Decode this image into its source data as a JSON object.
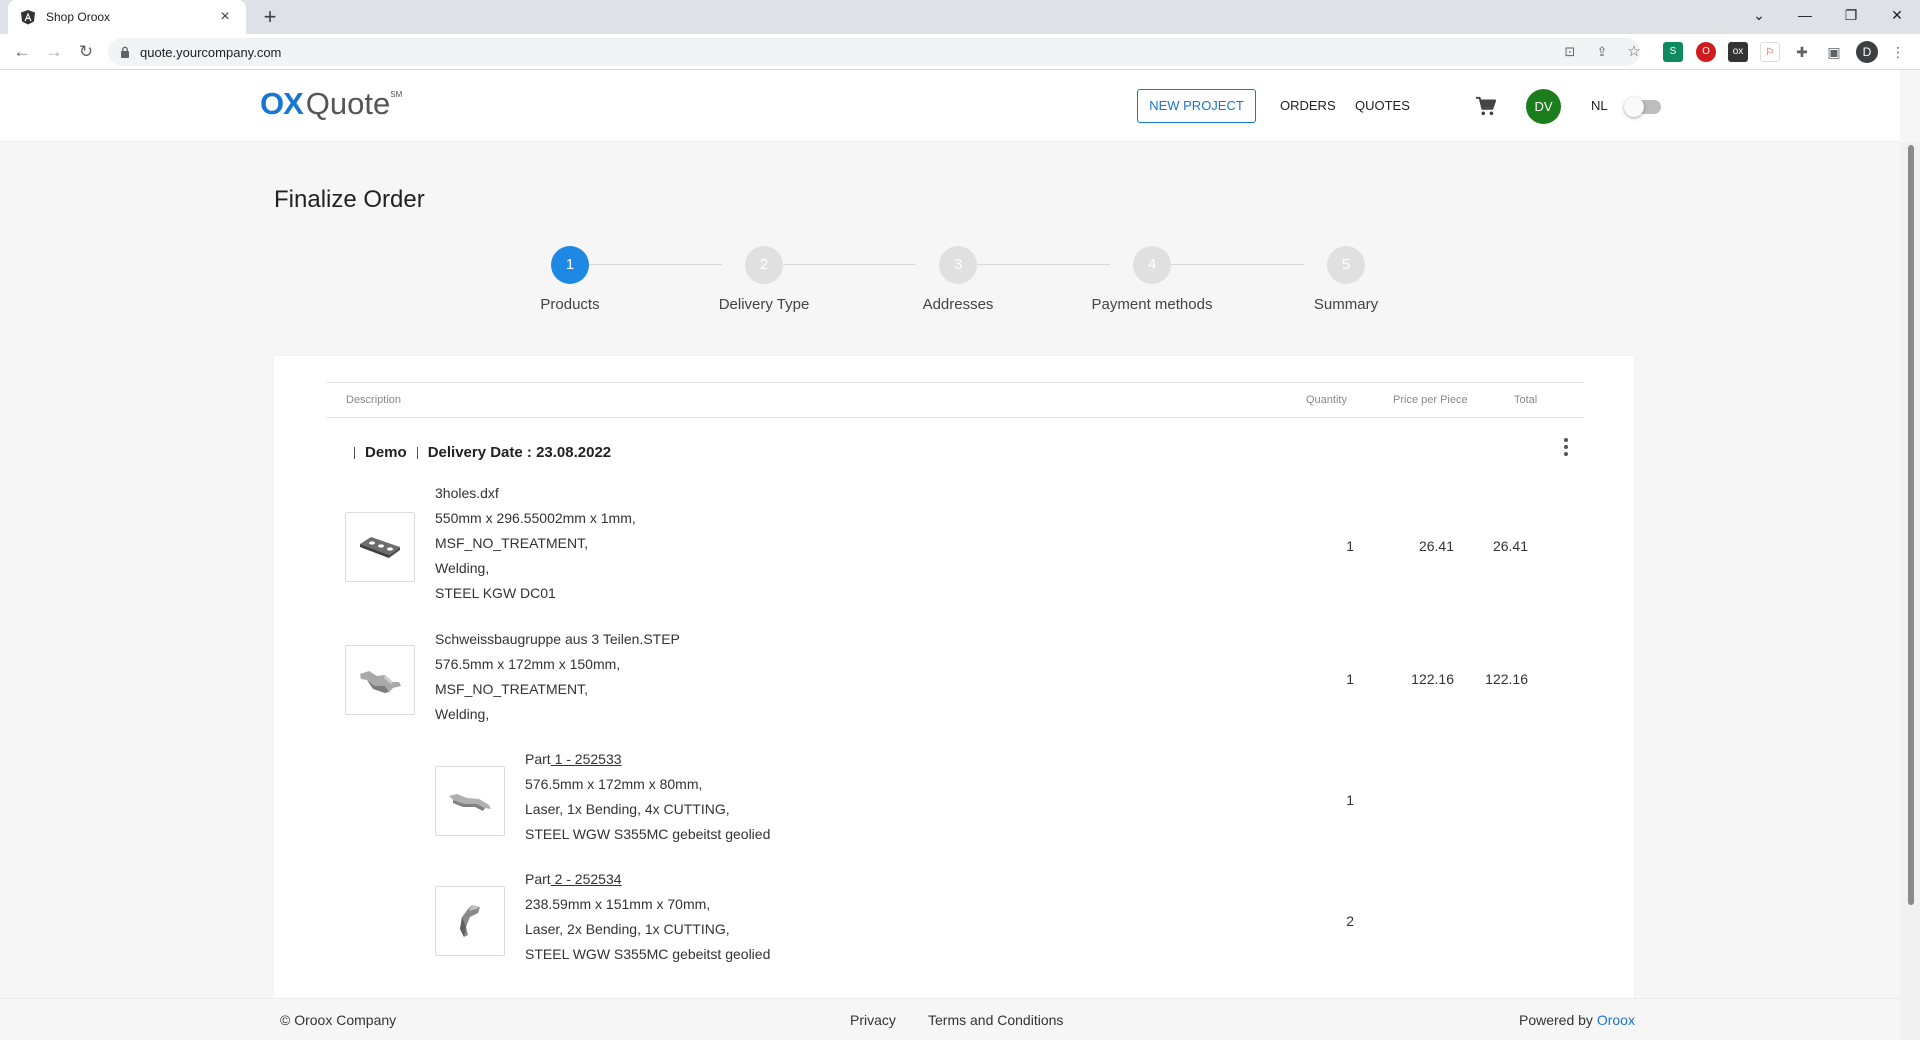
{
  "browser": {
    "tab_title": "Shop Oroox",
    "url": "quote.yourcompany.com",
    "profile_initial": "D"
  },
  "header": {
    "logo_ox": "OX",
    "logo_quote": "Quote",
    "logo_sm": "SM",
    "new_project": "NEW PROJECT",
    "orders": "ORDERS",
    "quotes": "QUOTES",
    "avatar": "DV",
    "lang": "NL"
  },
  "page": {
    "title": "Finalize Order",
    "steps": [
      {
        "num": "1",
        "label": "Products",
        "active": true
      },
      {
        "num": "2",
        "label": "Delivery Type",
        "active": false
      },
      {
        "num": "3",
        "label": "Addresses",
        "active": false
      },
      {
        "num": "4",
        "label": "Payment methods",
        "active": false
      },
      {
        "num": "5",
        "label": "Summary",
        "active": false
      }
    ]
  },
  "table": {
    "col_description": "Description",
    "col_quantity": "Quantity",
    "col_price": "Price per Piece",
    "col_total": "Total",
    "group_name": "Demo",
    "delivery_date": "Delivery Date : 23.08.2022",
    "items": [
      {
        "name": "3holes.dxf",
        "dims": "550mm x 296.55002mm x 1mm,",
        "treatment": "MSF_NO_TREATMENT,",
        "process": "Welding,",
        "material": "STEEL KGW DC01",
        "quantity": "1",
        "price": "26.41",
        "total": "26.41"
      },
      {
        "name": "Schweissbaugruppe aus 3 Teilen.STEP",
        "dims": "576.5mm x 172mm x 150mm,",
        "treatment": "MSF_NO_TREATMENT,",
        "process": "Welding,",
        "quantity": "1",
        "price": "122.16",
        "total": "122.16"
      }
    ],
    "parts": [
      {
        "prefix": "Part",
        "link": " 1 - 252533",
        "dims": "576.5mm x 172mm x 80mm,",
        "process": "Laser, 1x Bending, 4x CUTTING,",
        "material": "STEEL WGW S355MC gebeitst geolied",
        "quantity": "1"
      },
      {
        "prefix": "Part",
        "link": " 2 - 252534",
        "dims": "238.59mm x 151mm x 70mm,",
        "process": "Laser, 2x Bending, 1x CUTTING,",
        "material": "STEEL WGW S355MC gebeitst geolied",
        "quantity": "2"
      }
    ]
  },
  "footer": {
    "copyright": "© Oroox Company",
    "privacy": "Privacy",
    "terms": "Terms and Conditions",
    "powered_by": "Powered by",
    "powered_link": "Oroox"
  },
  "colors": {
    "primary": "#1976d2",
    "step_active": "#1e88e5",
    "avatar": "#1b7d1b"
  }
}
